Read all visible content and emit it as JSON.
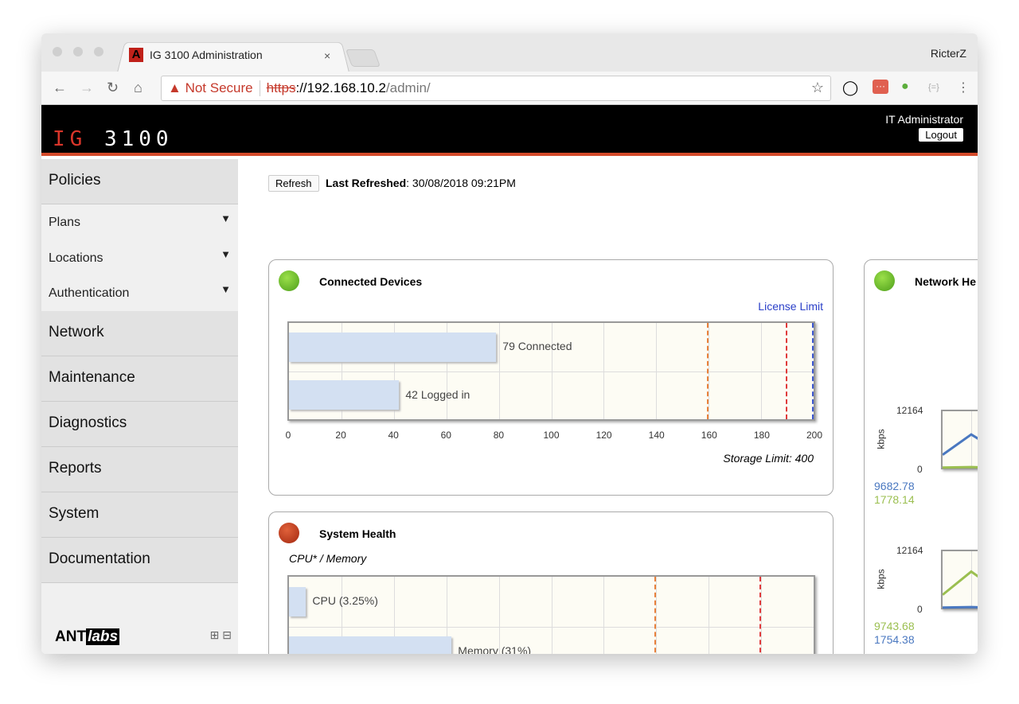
{
  "browser": {
    "tab_title": "IG 3100 Administration",
    "tab_close": "×",
    "user": "RicterZ",
    "not_secure": "Not Secure",
    "url_protocol": "https",
    "url_rest": "://192.168.10.2",
    "url_path": "/admin/",
    "favicon": "A"
  },
  "header": {
    "logo_red": "IG",
    "logo_white": "3100",
    "user_label": "IT Administrator",
    "logout_label": "Logout"
  },
  "sidebar": {
    "policies": "Policies",
    "sub_items": [
      {
        "label": "Plans"
      },
      {
        "label": "Locations"
      },
      {
        "label": "Authentication"
      }
    ],
    "sections": [
      "Network",
      "Maintenance",
      "Diagnostics",
      "Reports",
      "System",
      "Documentation"
    ],
    "brand_a": "ANT",
    "brand_b": "labs"
  },
  "toolbar": {
    "refresh_label": "Refresh",
    "last_refreshed_label": "Last Refreshed",
    "last_refreshed_value": ": 30/08/2018 09:21PM"
  },
  "colors": {
    "orange": "#e8803a",
    "red": "#e03a3a",
    "blue": "#3a55d0",
    "blue_line": "#4a78c0",
    "green_line": "#9bbf50"
  },
  "chart_data": [
    {
      "type": "bar",
      "title": "Connected Devices",
      "license_limit_label": "License Limit",
      "storage_limit_label": "Storage Limit: 400",
      "categories": [
        "Connected",
        "Logged in"
      ],
      "values": [
        79,
        42
      ],
      "bar_labels": [
        "79 Connected",
        "42 Logged in"
      ],
      "xlim": [
        0,
        200
      ],
      "ticks": [
        "0",
        "20",
        "40",
        "60",
        "80",
        "100",
        "120",
        "140",
        "160",
        "180",
        "200"
      ],
      "thresholds": [
        {
          "value": 160,
          "color": "#e8803a"
        },
        {
          "value": 190,
          "color": "#e03a3a"
        },
        {
          "value": 200,
          "color": "#3a55d0"
        }
      ],
      "status": "green"
    },
    {
      "type": "bar",
      "title": "System Health",
      "subtitle": "CPU* / Memory",
      "categories": [
        "CPU",
        "Memory"
      ],
      "values": [
        3.25,
        31
      ],
      "bar_labels": [
        "CPU (3.25%)",
        "Memory (31%)"
      ],
      "xlim": [
        0,
        100
      ],
      "thresholds": [
        {
          "value": 70,
          "color": "#e8803a"
        },
        {
          "value": 90,
          "color": "#e03a3a"
        }
      ],
      "status": "red"
    },
    {
      "type": "line",
      "title": "Network He",
      "ylabel": "kbps",
      "graphs": [
        {
          "ymax": "12164",
          "ymin": "0",
          "values": [
            "9682.78",
            "1778.14"
          ]
        },
        {
          "ymax": "12164",
          "ymin": "0",
          "values": [
            "9743.68",
            "1754.38"
          ]
        }
      ],
      "partial_label": "12164",
      "status": "green"
    }
  ]
}
